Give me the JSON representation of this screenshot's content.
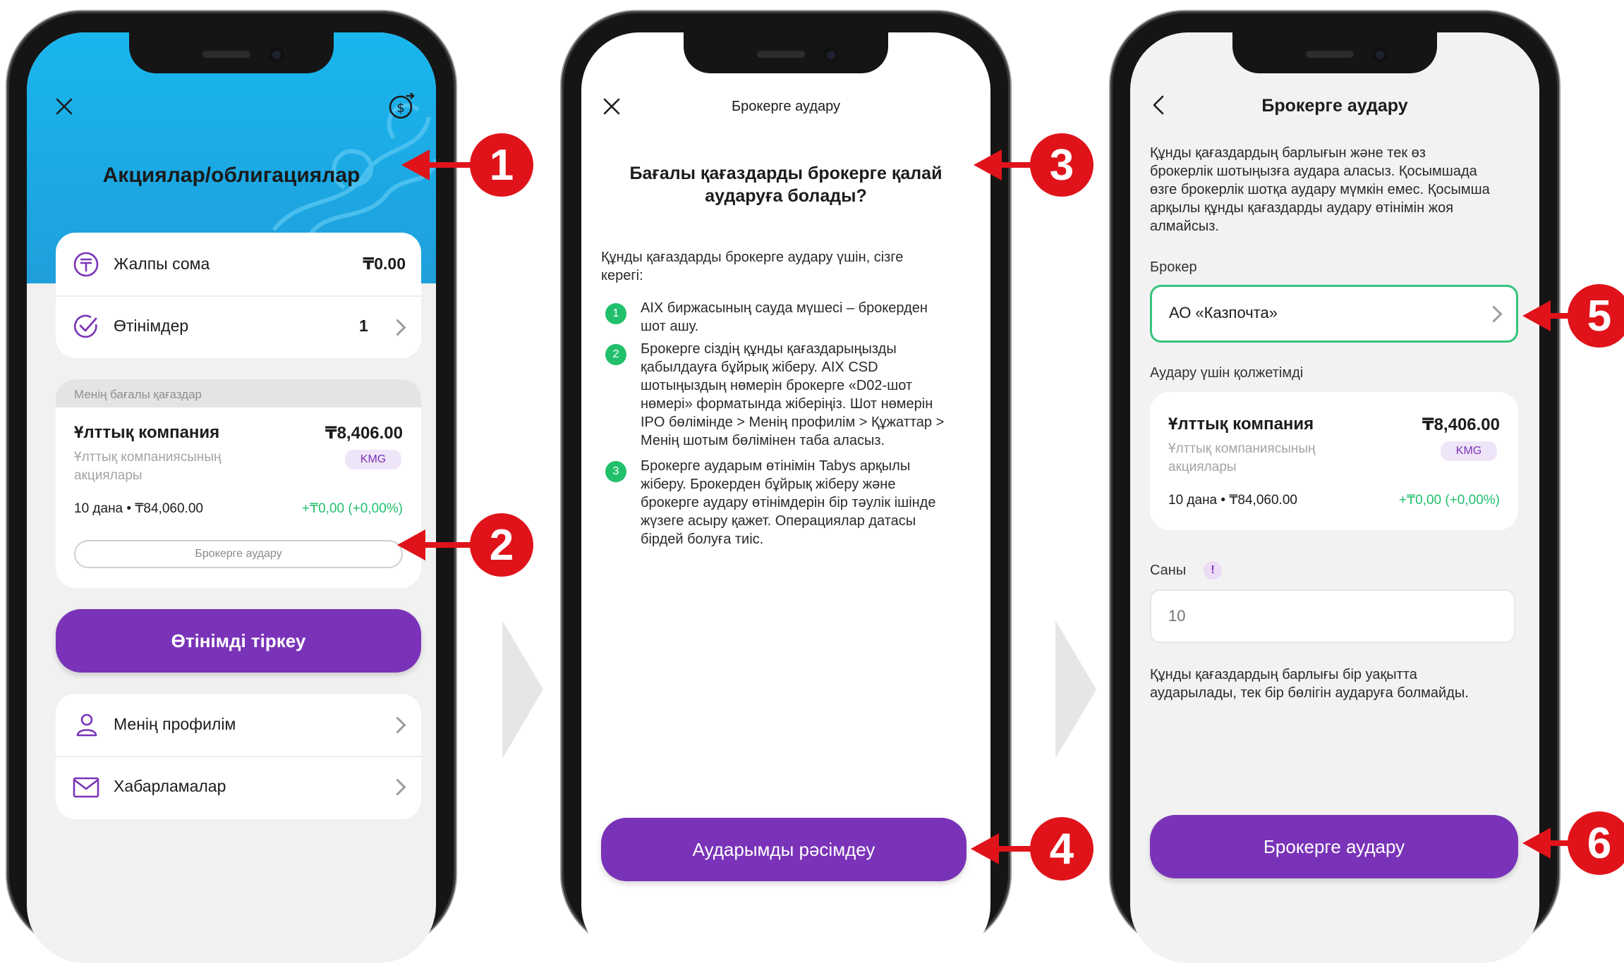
{
  "screen1": {
    "title": "Акциялар/облигациялар",
    "total_label": "Жалпы сома",
    "total_value": "₸0.00",
    "orders_label": "Өтінімдер",
    "orders_count": "1",
    "section_label": "Менің бағалы қағаздар",
    "security": {
      "name": "Ұлттық компания",
      "price": "₸8,406.00",
      "desc_line1": "Ұлттық компаниясының",
      "desc_line2": "акциялары",
      "ticker": "KMG",
      "qty": "10 дана • ₸84,060.00",
      "change": "+₸0,00 (+0,00%)"
    },
    "transfer_pill": "Брокерге аудару",
    "submit_button": "Өтінімді тіркеу",
    "menu_profile": "Менің профилім",
    "menu_notifications": "Хабарламалар"
  },
  "screen2": {
    "header": "Брокерге аудару",
    "question_line1": "Бағалы қағаздарды брокерге қалай",
    "question_line2": "аударуға болады?",
    "intro_line1": "Құнды қағаздарды брокерге аудару үшін, сізге",
    "intro_line2": "керегі:",
    "steps": [
      {
        "num": "1",
        "lines": [
          "AIX биржасының сауда мүшесі – брокерден",
          "шот ашу."
        ]
      },
      {
        "num": "2",
        "lines": [
          "Брокерге сіздің құнды қағаздарыңызды",
          "қабылдауға бұйрық жіберу. AIX CSD",
          "шотыңыздың нөмерін брокерге «D02-шот",
          "нөмері» форматында жіберіңіз. Шот нөмерін",
          "IPO бөлімінде > Менің профилім > Құжаттар >",
          "Менің шотым бөлімінен таба аласыз."
        ]
      },
      {
        "num": "3",
        "lines": [
          "Брокерге аударым өтінімін Tabys арқылы",
          "жіберу. Брокерден бұйрық жіберу және",
          "брокерге аудару өтінімдерін бір тәулік ішінде",
          "жүзеге асыру қажет. Операциялар датасы",
          "бірдей болуға тиіс."
        ]
      }
    ],
    "button": "Аударымды рәсімдеу"
  },
  "screen3": {
    "header": "Брокерге аудару",
    "info_lines": [
      "Құнды қағаздардың барлығын және тек өз",
      "брокерлік шотыңызға аудара аласыз. Қосымшада",
      "өзге брокерлік шотқа аудару мүмкін емес. Қосымша",
      "арқылы құнды қағаздарды аудару өтінімін жоя",
      "алмайсыз."
    ],
    "broker_label": "Брокер",
    "broker_value": "АО «Казпочта»",
    "available_label": "Аудару үшін қолжетімді",
    "security": {
      "name": "Ұлттық компания",
      "price": "₸8,406.00",
      "desc_line1": "Ұлттық компаниясының",
      "desc_line2": "акциялары",
      "ticker": "KMG",
      "qty": "10 дана • ₸84,060.00",
      "change": "+₸0,00 (+0,00%)"
    },
    "quantity_label": "Саны",
    "quantity_placeholder": "10",
    "note_line1": "Құнды қағаздардың барлығы бір уақытта",
    "note_line2": "аударылады, тек бір бөлігін аударуға болмайды.",
    "button": "Брокерге аудару"
  },
  "callouts": [
    "1",
    "2",
    "3",
    "4",
    "5",
    "6"
  ],
  "icons": {
    "close": "close-icon",
    "exchange": "currency-exchange-icon",
    "tenge": "tenge-circle-icon",
    "check": "check-circle-icon",
    "user": "user-icon",
    "mail": "mail-icon",
    "back": "back-arrow-icon",
    "info": "info-icon"
  },
  "colors": {
    "accent": "#7a33b8",
    "positive": "#22c06d",
    "callout": "#e0131a",
    "header_blue": "#1aa6e0"
  }
}
